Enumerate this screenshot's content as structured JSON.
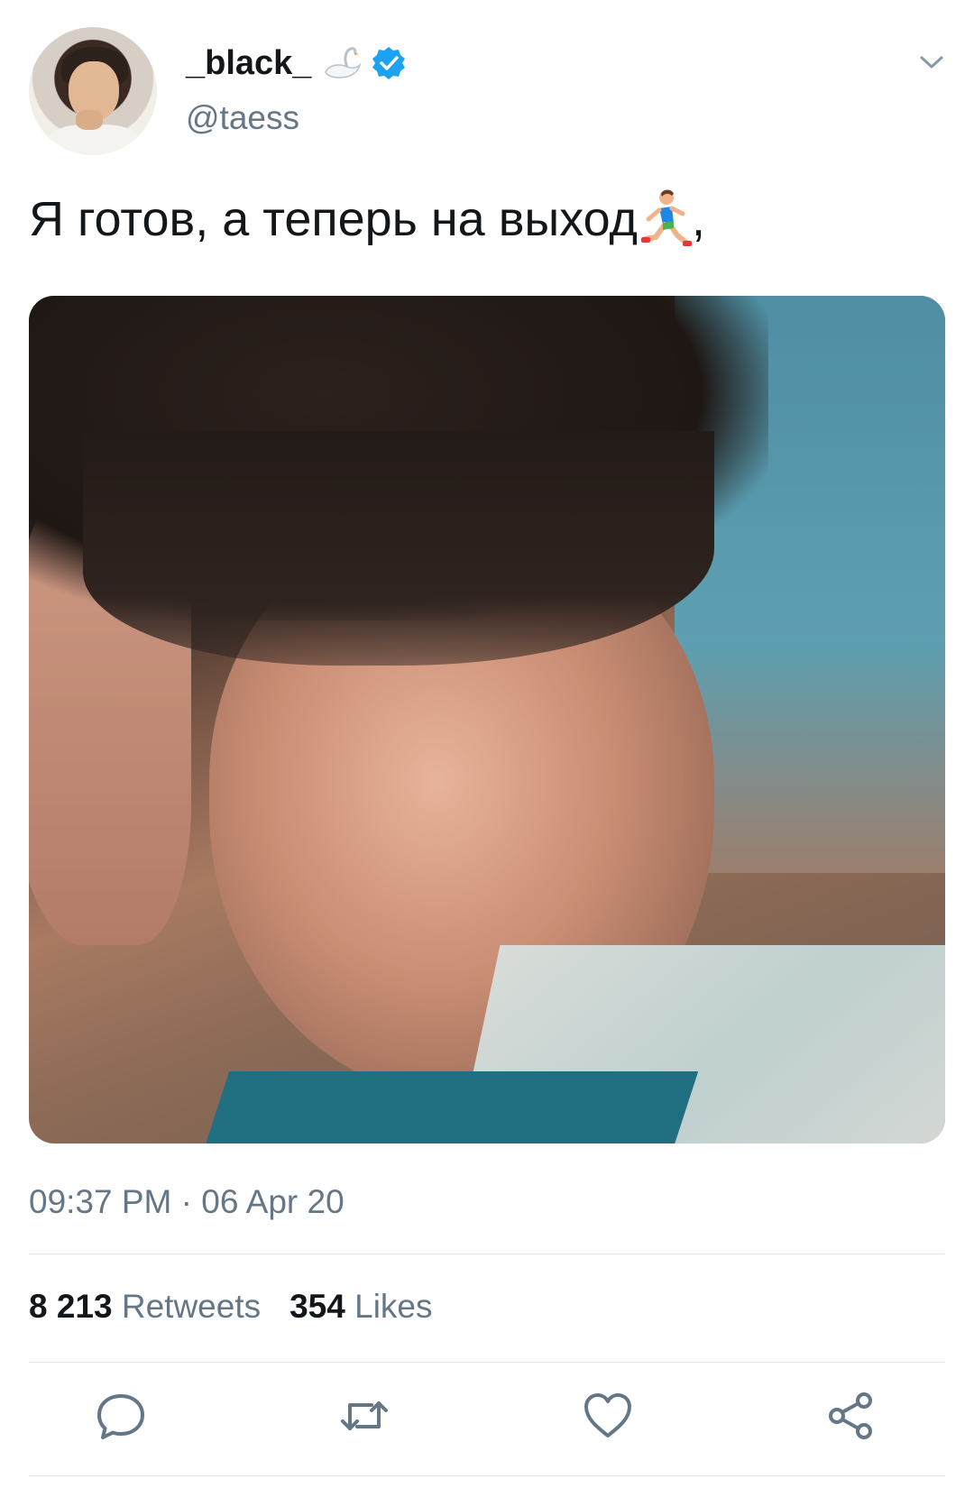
{
  "user": {
    "display_name": "_black_",
    "name_emoji": "swan-icon",
    "verified": true,
    "handle": "@taess",
    "verified_color": "#1da1f2"
  },
  "tweet": {
    "text": "Я готов, а теперь на выход",
    "trailing_emoji": "runner-icon",
    "trailing_punct": ",",
    "timestamp": "09:37 PM · 06 Apr 20"
  },
  "stats": {
    "retweets_count": "8 213",
    "retweets_label": "Retweets",
    "likes_count": "354",
    "likes_label": "Likes"
  },
  "actions": [
    "reply-icon",
    "retweet-icon",
    "like-icon",
    "share-icon"
  ],
  "colors": {
    "text_primary": "#14171a",
    "text_secondary": "#657786",
    "divider": "#e1e8ed",
    "icon": "#657786"
  }
}
